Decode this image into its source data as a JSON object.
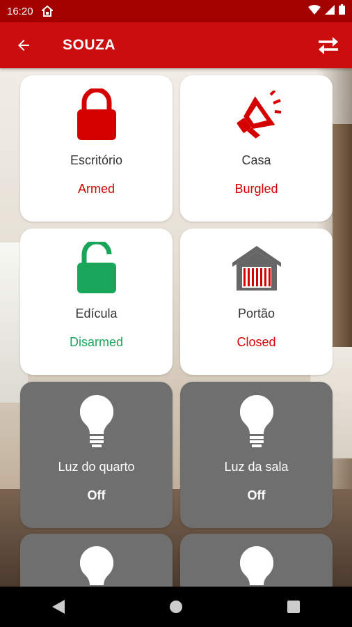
{
  "status_bar": {
    "time": "16:20"
  },
  "app_bar": {
    "title": "SOUZA"
  },
  "colors": {
    "brand_red": "#cc0d0d",
    "armed_red": "#d40000",
    "disarmed_green": "#1aa65a",
    "light_card_gray": "#6f6f6f"
  },
  "devices": [
    {
      "name": "Escritório",
      "state": "Armed",
      "icon": "lock-closed-icon"
    },
    {
      "name": "Casa",
      "state": "Burgled",
      "icon": "megaphone-icon"
    },
    {
      "name": "Edícula",
      "state": "Disarmed",
      "icon": "lock-open-icon"
    },
    {
      "name": "Portão",
      "state": "Closed",
      "icon": "garage-icon"
    },
    {
      "name": "Luz do quarto",
      "state": "Off",
      "icon": "lightbulb-icon"
    },
    {
      "name": "Luz da sala",
      "state": "Off",
      "icon": "lightbulb-icon"
    },
    {
      "name": "",
      "state": "",
      "icon": "lightbulb-icon"
    },
    {
      "name": "",
      "state": "",
      "icon": "lightbulb-icon"
    }
  ]
}
